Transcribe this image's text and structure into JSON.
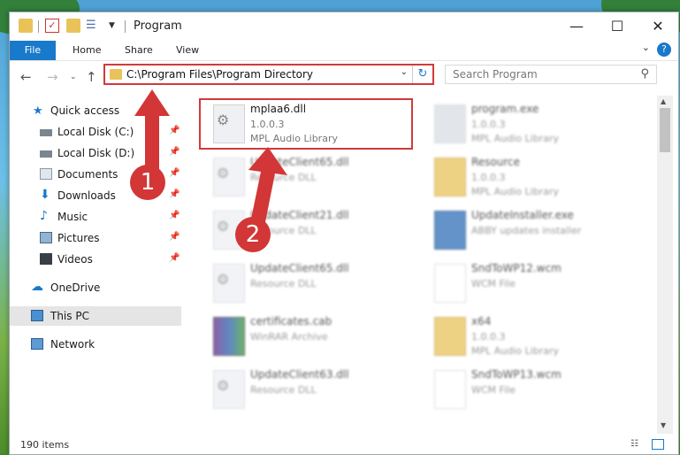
{
  "titlebar": {
    "title": "Program",
    "minimize": "—",
    "maximize": "☐",
    "close": "✕"
  },
  "ribbon": {
    "tabs": [
      "File",
      "Home",
      "Share",
      "View"
    ],
    "help": "?"
  },
  "address": {
    "path": "C:\\Program Files\\Program Directory",
    "refresh": "↻"
  },
  "search": {
    "placeholder": "Search Program"
  },
  "sidebar": {
    "items": [
      {
        "label": "Quick access"
      },
      {
        "label": "Local Disk (C:)"
      },
      {
        "label": "Local Disk (D:)"
      },
      {
        "label": "Documents"
      },
      {
        "label": "Downloads"
      },
      {
        "label": "Music"
      },
      {
        "label": "Pictures"
      },
      {
        "label": "Videos"
      },
      {
        "label": "OneDrive"
      },
      {
        "label": "This PC"
      },
      {
        "label": "Network"
      }
    ]
  },
  "files": [
    {
      "name": "mplaa6.dll",
      "line2": "1.0.0.3",
      "line3": "MPL Audio Library"
    },
    {
      "name": "program.exe",
      "line2": "1.0.0.3",
      "line3": "MPL Audio Library"
    },
    {
      "name": "UpdateClient65.dll",
      "line2": "Resource DLL",
      "line3": ""
    },
    {
      "name": "Resource",
      "line2": "1.0.0.3",
      "line3": "MPL Audio Library"
    },
    {
      "name": "UpdateClient21.dll",
      "line2": "Resource DLL",
      "line3": ""
    },
    {
      "name": "UpdateInstaller.exe",
      "line2": "ABBY updates installer",
      "line3": ""
    },
    {
      "name": "UpdateClient65.dll",
      "line2": "Resource DLL",
      "line3": ""
    },
    {
      "name": "SndToWP12.wcm",
      "line2": "WCM File",
      "line3": ""
    },
    {
      "name": "certificates.cab",
      "line2": "WinRAR Archive",
      "line3": ""
    },
    {
      "name": "x64",
      "line2": "1.0.0.3",
      "line3": "MPL Audio Library"
    },
    {
      "name": "UpdateClient63.dll",
      "line2": "Resource DLL",
      "line3": ""
    },
    {
      "name": "SndToWP13.wcm",
      "line2": "WCM File",
      "line3": ""
    }
  ],
  "status": {
    "count": "190 items"
  },
  "markers": [
    "1",
    "2"
  ],
  "colors": {
    "accent": "#1979ca",
    "highlight": "#d23a3a"
  }
}
